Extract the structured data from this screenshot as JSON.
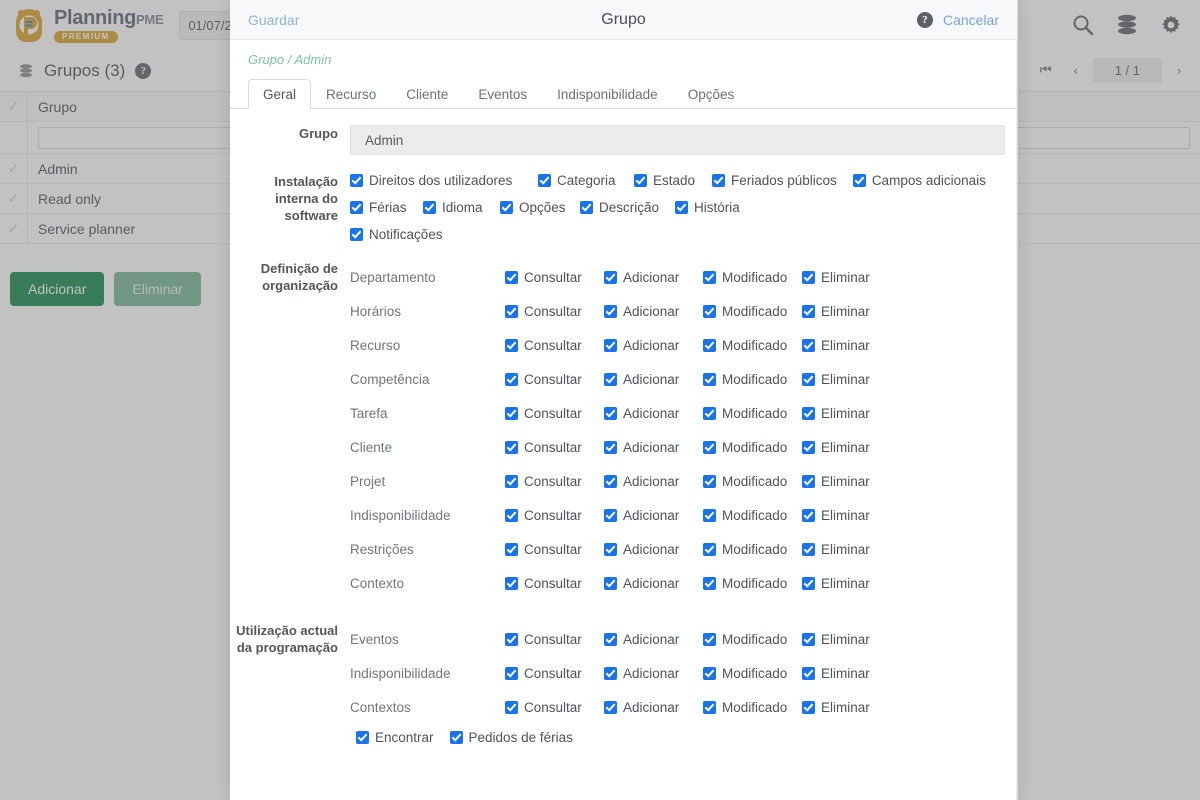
{
  "app": {
    "logo_name": "Planning",
    "logo_suffix": "PME",
    "logo_badge": "PREMIUM",
    "date_value": "01/07/2",
    "toolbar_icons": [
      "search-icon",
      "database-icon",
      "gear-icon"
    ],
    "section_title": "Grupos (3)",
    "help_glyph": "?",
    "pager": {
      "first_label": "⏮",
      "prev_label": "‹",
      "count": "1 / 1",
      "next_label": "›"
    },
    "table": {
      "columns": [
        "Grupo"
      ],
      "filter_value": "",
      "rows": [
        "Admin",
        "Read only",
        "Service planner"
      ]
    },
    "buttons": {
      "add": "Adicionar",
      "delete": "Eliminar"
    }
  },
  "modal": {
    "save_label": "Guardar",
    "title": "Grupo",
    "cancel_label": "Cancelar",
    "help_glyph": "?",
    "breadcrumb": "Grupo / Admin",
    "tabs": [
      {
        "label": "Geral",
        "active": true
      },
      {
        "label": "Recurso",
        "active": false
      },
      {
        "label": "Cliente",
        "active": false
      },
      {
        "label": "Eventos",
        "active": false
      },
      {
        "label": "Indisponibilidade",
        "active": false
      },
      {
        "label": "Opções",
        "active": false
      }
    ],
    "form": {
      "group_label": "Grupo",
      "group_value": "Admin",
      "software_label": "Instalação interna do software",
      "software_checks": [
        {
          "label": "Direitos dos utilizadores",
          "checked": true
        },
        {
          "label": "Categoria",
          "checked": true
        },
        {
          "label": "Estado",
          "checked": true
        },
        {
          "label": "Feriados públicos",
          "checked": true
        },
        {
          "label": "Campos adicionais",
          "checked": true
        },
        {
          "label": "Férias",
          "checked": true
        },
        {
          "label": "Idioma",
          "checked": true
        },
        {
          "label": "Opções",
          "checked": true
        },
        {
          "label": "Descrição",
          "checked": true
        },
        {
          "label": "História",
          "checked": true
        },
        {
          "label": "Notificações",
          "checked": true
        }
      ],
      "permission_columns": [
        "Consultar",
        "Adicionar",
        "Modificado",
        "Eliminar"
      ],
      "org_label": "Definição de organização",
      "org_rows": [
        {
          "name": "Departamento",
          "perms": [
            true,
            true,
            true,
            true
          ]
        },
        {
          "name": "Horários",
          "perms": [
            true,
            true,
            true,
            true
          ]
        },
        {
          "name": "Recurso",
          "perms": [
            true,
            true,
            true,
            true
          ]
        },
        {
          "name": "Competência",
          "perms": [
            true,
            true,
            true,
            true
          ]
        },
        {
          "name": "Tarefa",
          "perms": [
            true,
            true,
            true,
            true
          ]
        },
        {
          "name": "Cliente",
          "perms": [
            true,
            true,
            true,
            true
          ]
        },
        {
          "name": "Projet",
          "perms": [
            true,
            true,
            true,
            true
          ]
        },
        {
          "name": "Indisponibilidade",
          "perms": [
            true,
            true,
            true,
            true
          ]
        },
        {
          "name": "Restrições",
          "perms": [
            true,
            true,
            true,
            true
          ]
        },
        {
          "name": "Contexto",
          "perms": [
            true,
            true,
            true,
            true
          ]
        }
      ],
      "usage_label": "Utilização actual da programação",
      "usage_rows": [
        {
          "name": "Eventos",
          "perms": [
            true,
            true,
            true,
            true
          ]
        },
        {
          "name": "Indisponibilidade",
          "perms": [
            true,
            true,
            true,
            true
          ]
        },
        {
          "name": "Contextos",
          "perms": [
            true,
            true,
            true,
            true
          ]
        }
      ],
      "usage_extra": [
        {
          "label": "Encontrar",
          "checked": true
        },
        {
          "label": "Pedidos de férias",
          "checked": true
        }
      ]
    }
  },
  "colors": {
    "accent_blue": "#1a73e8",
    "link_blue": "#77a5d6",
    "breadcrumb_green": "#7fc4a0",
    "button_green": "#14874f",
    "logo_gold": "#d9a326"
  }
}
